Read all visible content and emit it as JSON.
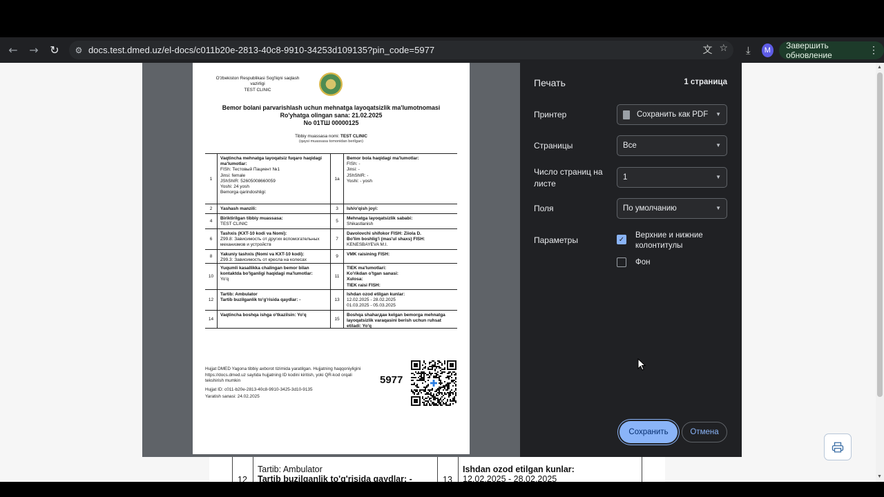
{
  "browser": {
    "url": "docs.test.dmed.uz/el-docs/c011b20e-2813-40c8-9910-34253d109135?pin_code=5977",
    "avatar_letter": "M",
    "update_label": "Завершить обновление"
  },
  "document": {
    "header_left": "O'zbekiston Respublikasi Sog'liqni saqlash vazirligi",
    "header_clinic": "TEST CLINIC",
    "title_line1": "Bemor bolani parvarishlash uchun mehnatga layoqatsizlik ma'lumotnomasi",
    "title_line2": "Ro'yhatga olingan sana: 21.02.2025",
    "title_line3": "No 01ТШ 00000125",
    "institution_label": "Tibbiy muassasa nomi:",
    "institution_value": "TEST CLINIC",
    "institution_note": "(qaysi muassasa tomonidan berilgan)",
    "rows": [
      {
        "n1": "1",
        "l1": "Vaqtincha mehnatga layoqatsiz fuqaro haqidagi ma'lumotlar:",
        "v1": "FISh: Тестовый Пациент №1\nJinsi: female\nJShShIR: 52605008660059\nYoshi: 24 yosh\nBemorga qarindoshligi:",
        "n2": "1a",
        "l2": "Bemor bola haqidagi ma'lumotlar:",
        "v2": "FISh: -\nJinsi: -\nJShShIR: -\nYoshi: - yosh"
      },
      {
        "n1": "2",
        "l1": "Yashash manzili:",
        "v1": "",
        "n2": "3",
        "l2": "Ish/o'qish joyi:",
        "v2": ""
      },
      {
        "n1": "4",
        "l1": "Biriktirilgan tibbiy muassasa:",
        "v1": "TEST CLINIC",
        "n2": "5",
        "l2": "Mehnatga layoqatsizlik sababi:",
        "v2": "Shikastlanish"
      },
      {
        "n1": "6",
        "l1": "Tashxis (KXT-10 kodi va Nomi):",
        "v1": "Z99.8: Зависимость от других вспомогательных механизмов и устройств",
        "n2": "7",
        "l2": "Davolovchi shifokor FISH: Ziiola D.\nBo'lim boshlig'i (mas'ul shaxs) FISH:",
        "v2": "KENESBAYEVA M.I."
      },
      {
        "n1": "8",
        "l1": "Yakuniy tashxis (Nomi va KXT-10 kodi):",
        "v1": "Z99.3: Зависимость от кресла на колесах",
        "n2": "9",
        "l2": "VMK raisining FISH:",
        "v2": ""
      },
      {
        "n1": "10",
        "l1": "Yuqumli kasallikka chalingan bemor bilan kontaktda bo'lganligi haqidagi ma'lumotlar:",
        "v1": "Yo'q",
        "n2": "11",
        "l2": "TIEK ma'lumotlari:\nKo'rikdan o'tgan sanasi:\nXulosa:\nTIEK raisi FISH:",
        "v2": ""
      },
      {
        "n1": "12",
        "l1": "Tartib: Ambulator\nTartib buzilganlik to'g'risida qaydlar: -",
        "v1": "",
        "n2": "13",
        "l2": "Ishdan ozod etilgan kunlar:",
        "v2": "12.02.2025 - 28.02.2025\n01.03.2025 - 05.03.2025"
      },
      {
        "n1": "14",
        "l1": "Vaqtincha boshqa ishga o'tkazilsin: Yo'q",
        "v1": "",
        "n2": "15",
        "l2": "Boshqa shaharдан kelgan bemorga mehnatga layoqatsizlik varaqasini berish uchun ruhsat etiladi: Yo'q",
        "v2": ""
      }
    ],
    "footer_text": "Hujjat DMED Yagona tibbiy axborot tizimida yaratilgan. Hujjatning haqqoniyligini https://docs.dmed.uz saytida hujjatning ID kodini kiritish, yoki QR-kod orqali tekshirish mumkin",
    "doc_id": "Hujjat ID: c011-b20e-2813-40c8-9910-3425-3d10-9135",
    "created": "Yaratish sanasi: 24.02.2025",
    "pin": "5977"
  },
  "background_page": {
    "row_num": "12",
    "tartib": "Tartib: Ambulator",
    "tartib_buz": "Tartib buzilganlik to'g'risida qaydlar: -",
    "row_num2": "13",
    "ishdan": "Ishdan ozod etilgan kunlar:",
    "dates": "12.02.2025 - 28.02.2025"
  },
  "print_dialog": {
    "title": "Печать",
    "page_count": "1 страница",
    "printer_label": "Принтер",
    "printer_value": "Сохранить как PDF",
    "pages_label": "Страницы",
    "pages_value": "Все",
    "per_sheet_label": "Число страниц на листе",
    "per_sheet_value": "1",
    "margins_label": "Поля",
    "margins_value": "По умолчанию",
    "options_label": "Параметры",
    "headers_footers_label": "Верхние и нижние колонтитулы",
    "headers_footers_checked": true,
    "background_label": "Фон",
    "background_checked": false,
    "save_label": "Сохранить",
    "cancel_label": "Отмена"
  }
}
